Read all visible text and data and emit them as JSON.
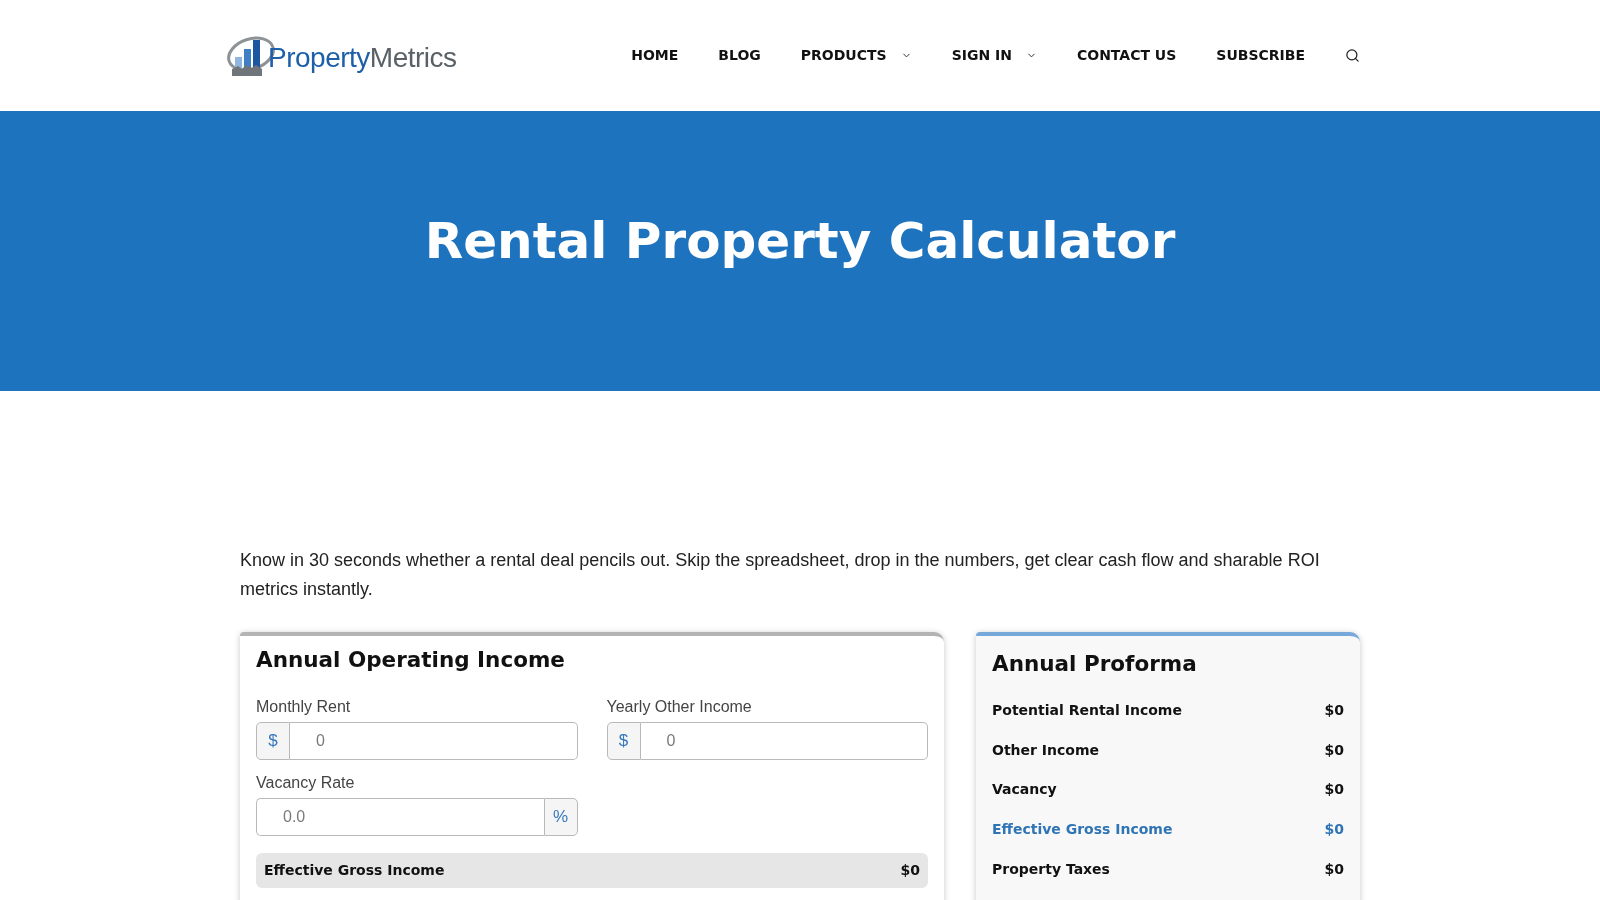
{
  "header": {
    "logo": {
      "text_start": "Property",
      "text_end": "Metrics"
    },
    "nav": [
      {
        "label": "HOME",
        "kind": "link"
      },
      {
        "label": "BLOG",
        "kind": "link"
      },
      {
        "label": "PRODUCTS",
        "kind": "menu"
      },
      {
        "label": "SIGN IN",
        "kind": "menu"
      },
      {
        "label": "CONTACT US",
        "kind": "link"
      },
      {
        "label": "SUBSCRIBE",
        "kind": "link"
      }
    ]
  },
  "hero": {
    "title": "Rental Property Calculator"
  },
  "intro": "Know in 30 seconds whether a rental deal pencils out. Skip the spreadsheet, drop in the numbers, get clear cash flow and sharable ROI metrics instantly.",
  "income_card": {
    "title": "Annual Operating Income",
    "fields": [
      {
        "label": "Monthly Rent",
        "kind": "prefix",
        "addon": "$",
        "placeholder": "0"
      },
      {
        "label": "Yearly Other Income",
        "kind": "prefix",
        "addon": "$",
        "placeholder": "0"
      },
      {
        "label": "Vacancy Rate",
        "kind": "suffix",
        "addon": "%",
        "placeholder": "0.0"
      }
    ],
    "total": {
      "label": "Effective Gross Income",
      "value": "$0"
    }
  },
  "proforma": {
    "title": "Annual Proforma",
    "rows": [
      {
        "label": "Potential Rental Income",
        "value": "$0",
        "kind": "item"
      },
      {
        "label": "Other Income",
        "value": "$0",
        "kind": "item"
      },
      {
        "label": "Vacancy",
        "value": "$0",
        "kind": "item"
      },
      {
        "label": "Effective Gross Income",
        "value": "$0",
        "kind": "subtotal"
      },
      {
        "label": "Property Taxes",
        "value": "$0",
        "kind": "item"
      }
    ]
  }
}
